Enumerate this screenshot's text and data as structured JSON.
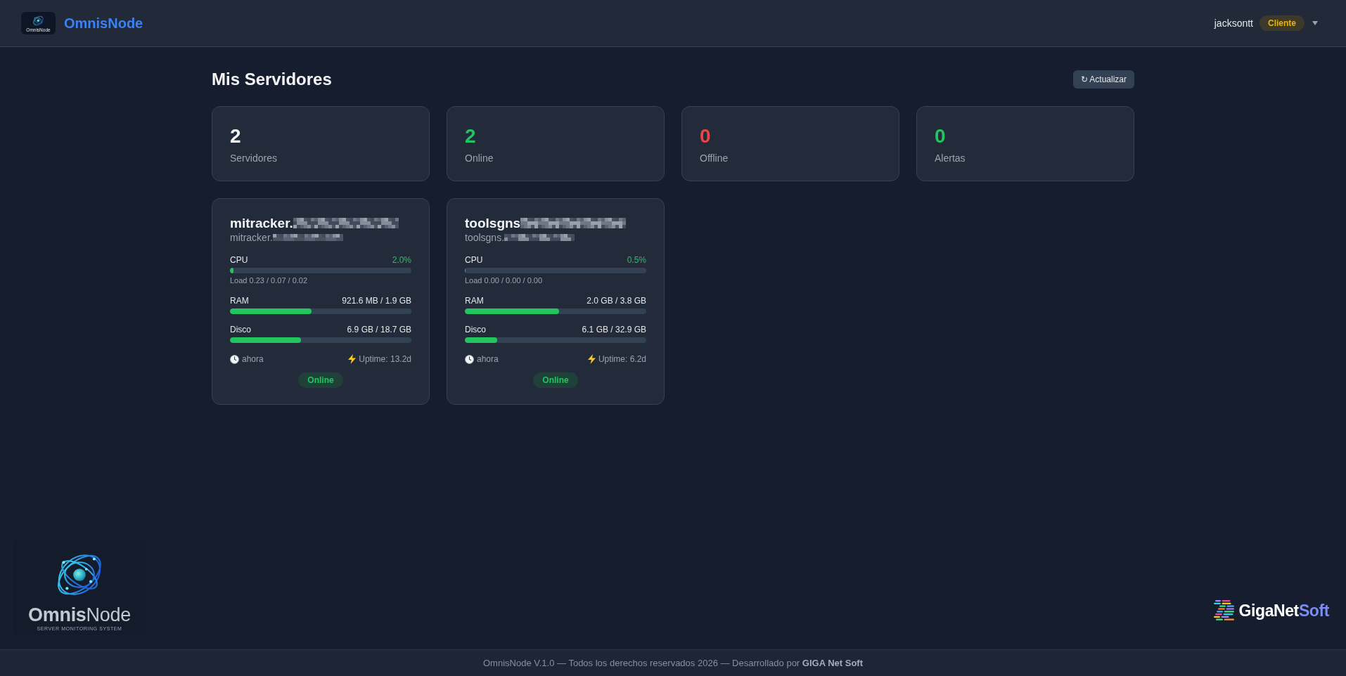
{
  "header": {
    "logo": {
      "caption": "OmnisNode"
    },
    "title": "OmnisNode",
    "user": {
      "name": "jacksontt",
      "role": "Cliente"
    }
  },
  "page": {
    "title": "Mis Servidores",
    "refresh_button": "↻ Actualizar"
  },
  "stats": [
    {
      "value": "2",
      "label": "Servidores",
      "color": "#f3f4f6"
    },
    {
      "value": "2",
      "label": "Online",
      "color": "#22c55e"
    },
    {
      "value": "0",
      "label": "Offline",
      "color": "#ef4444"
    },
    {
      "value": "0",
      "label": "Alertas",
      "color": "#22c55e"
    }
  ],
  "servers": [
    {
      "name": "mitracker.",
      "host": "mitracker.",
      "metrics": [
        {
          "kind": "cpu",
          "label": "CPU",
          "reading": "2.0%",
          "level": 0.02,
          "note": "Load 0.23 / 0.07 / 0.02"
        },
        {
          "kind": "memory",
          "label": "RAM",
          "reading": "921.6 MB / 1.9 GB",
          "level": 0.45
        },
        {
          "kind": "disk",
          "label": "Disco",
          "reading": "6.9 GB / 18.7 GB",
          "level": 0.39
        }
      ],
      "last_seen": "ahora",
      "uptime": "Uptime: 13.2d",
      "status": "Online",
      "online": true
    },
    {
      "name": "toolsgns",
      "host": "toolsgns.",
      "metrics": [
        {
          "kind": "cpu",
          "label": "CPU",
          "reading": "0.5%",
          "level": 0.005,
          "note": "Load 0.00 / 0.00 / 0.00"
        },
        {
          "kind": "memory",
          "label": "RAM",
          "reading": "2.0 GB / 3.8 GB",
          "level": 0.52
        },
        {
          "kind": "disk",
          "label": "Disco",
          "reading": "6.1 GB / 32.9 GB",
          "level": 0.18
        }
      ],
      "last_seen": "ahora",
      "uptime": "Uptime: 6.2d",
      "status": "Online",
      "online": true
    }
  ],
  "branding": {
    "product_logo": {
      "name": "**Omnis**Node",
      "tagline": "SERVER MONITORING SYSTEM"
    },
    "company_logo": {
      "name": "GigaNet",
      "accent": "Soft"
    }
  },
  "footer": {
    "text": "OmnisNode V.1.0 — Todos los derechos reservados 2026 — Desarrollado por **GIGA Net Soft**"
  }
}
